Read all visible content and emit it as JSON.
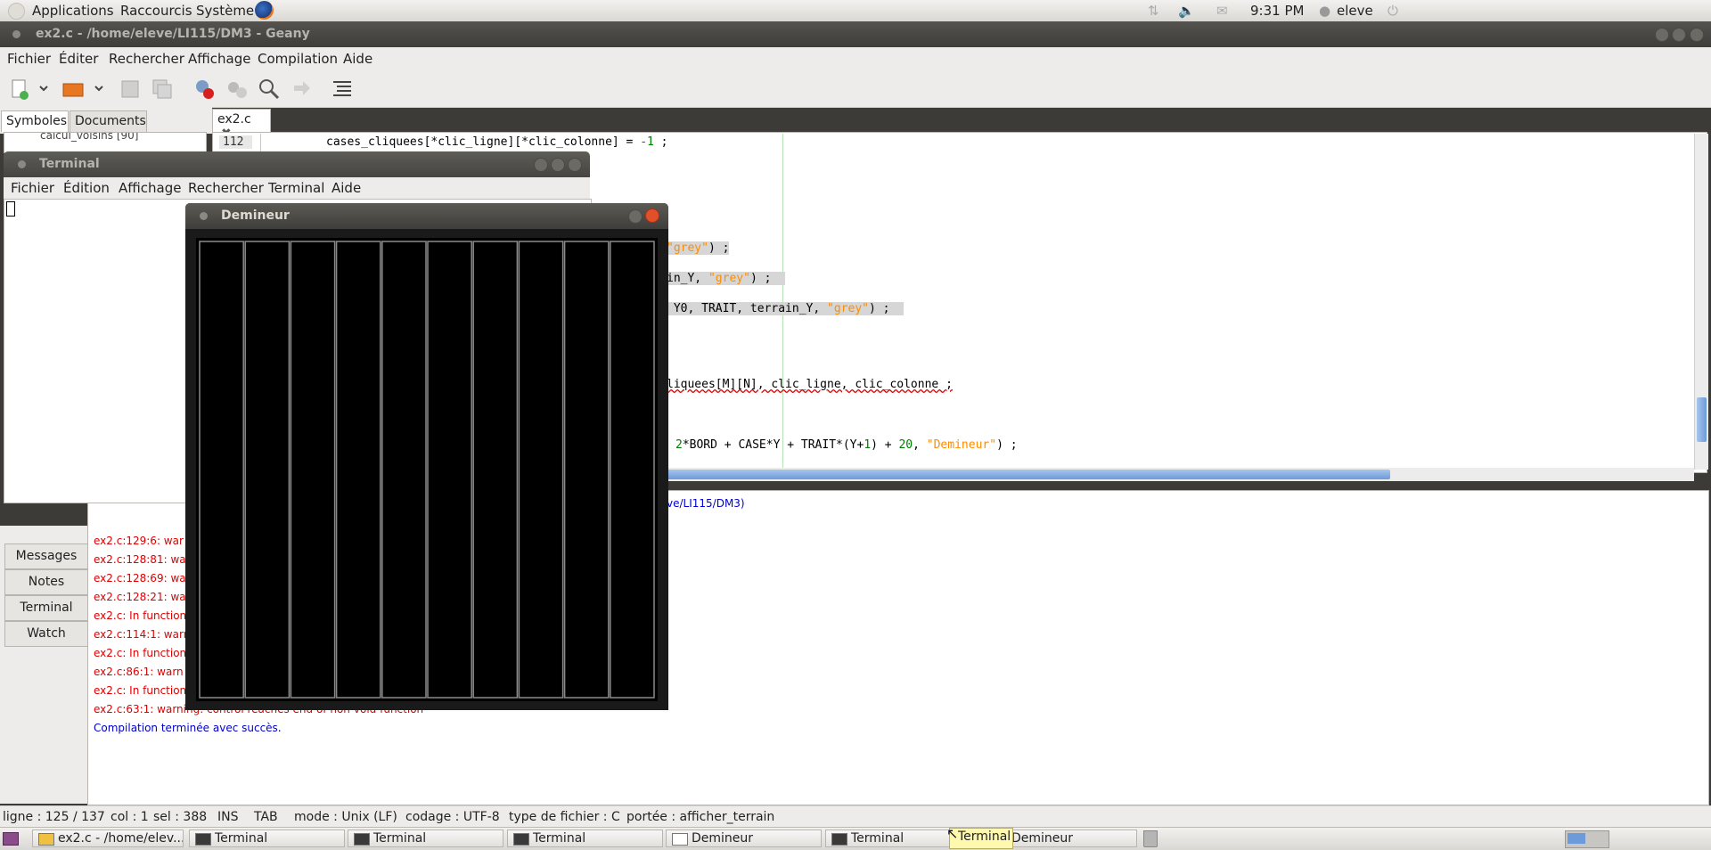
{
  "top_panel": {
    "menus": [
      "Applications",
      "Raccourcis",
      "Système"
    ],
    "clock": "9:31 PM",
    "user": "eleve"
  },
  "geany": {
    "title": "ex2.c - /home/eleve/LI115/DM3 - Geany",
    "menu": [
      "Fichier",
      "Éditer",
      "Rechercher",
      "Affichage",
      "Compilation",
      "Aide"
    ],
    "sidebar_tabs": [
      "Symboles",
      "Documents"
    ],
    "sidebar_symbol_partial": "calcul_voisins [90]",
    "file_tab": "ex2.c",
    "line_number": "112",
    "code": {
      "l1": "cases_cliquees[*clic_ligne][*clic_colonne] = ",
      "l1_num": "-1",
      "l1_end": " ;",
      "l2_str": "\"grey\"",
      "l2_end": ") ;",
      "l3_pre": "in_Y, ",
      "l3_str": "\"grey\"",
      "l3_end": ") ;",
      "l4_pre": " Y0, TRAIT, terrain_Y, ",
      "l4_str": "\"grey\"",
      "l4_end": ") ;",
      "l5": "liquees[M][N], clic_ligne, clic_colonne ;",
      "l6_num1": "2",
      "l6_mid": "*BORD + CASE*Y + TRAIT*(Y+",
      "l6_num2": "1",
      "l6_mid2": ") + ",
      "l6_num3": "20",
      "l6_mid3": ", ",
      "l6_str": "\"Demineur\"",
      "l6_end": ") ;"
    },
    "compiler_dir_partial": "ve/LI115/DM3)",
    "msg_tabs": [
      "Messages",
      "Notes",
      "Terminal",
      "Watch"
    ],
    "messages": [
      "ex2.c:129:6: war",
      "ex2.c:128:81: wa",
      "ex2.c:128:69: wa",
      "ex2.c:128:21: wa",
      "ex2.c: In function",
      "ex2.c:114:1: warn",
      "ex2.c: In function",
      "ex2.c:86:1: warn",
      "ex2.c: In function",
      "ex2.c:63:1: warning: control reaches end of non-void function"
    ],
    "compile_success": "Compilation terminée avec succès.",
    "status": {
      "ligne": "ligne : 125 / 137",
      "col": "col : 1",
      "sel": "sel : 388",
      "ins": "INS",
      "tab": "TAB",
      "mode": "mode : Unix (LF)",
      "codage": "codage : UTF-8",
      "type": "type de fichier : C",
      "portee": "portée : afficher_terrain"
    }
  },
  "terminal": {
    "title": "Terminal",
    "menu": [
      "Fichier",
      "Édition",
      "Affichage",
      "Rechercher",
      "Terminal",
      "Aide"
    ]
  },
  "demineur": {
    "title": "Demineur",
    "columns": 10,
    "colors": {
      "background": "#000000",
      "grid": "#8a8a8a"
    }
  },
  "taskbar": {
    "items": [
      "ex2.c - /home/elev...",
      "Terminal",
      "Terminal",
      "Terminal",
      "Demineur",
      "Terminal",
      "Demineur"
    ],
    "tooltip": "Terminal"
  }
}
